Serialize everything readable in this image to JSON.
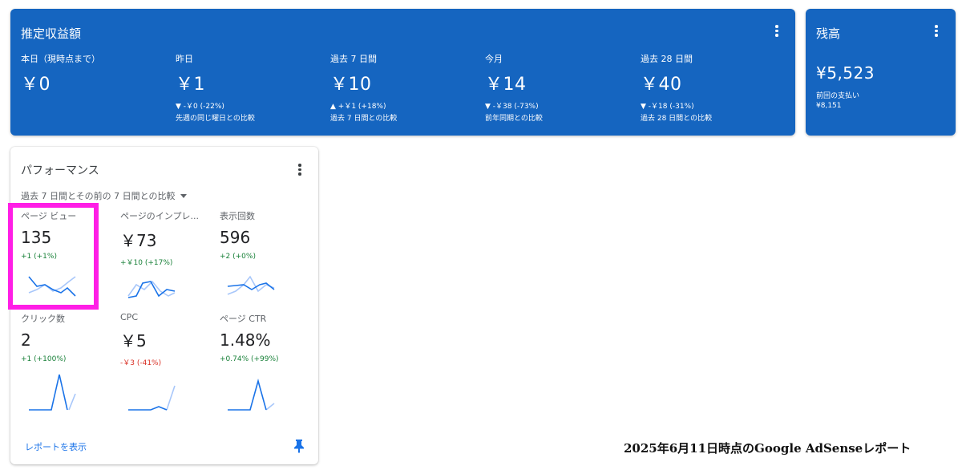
{
  "earnings": {
    "title": "推定収益額",
    "metrics": [
      {
        "label": "本日（現時点まで）",
        "value": "￥0",
        "change": "",
        "compare": ""
      },
      {
        "label": "昨日",
        "value": "￥1",
        "change": "▼ -￥0 (-22%)",
        "compare": "先週の同じ曜日との比較"
      },
      {
        "label": "過去 7 日間",
        "value": "￥10",
        "change": "▲ +￥1 (+18%)",
        "compare": "過去 7 日間との比較"
      },
      {
        "label": "今月",
        "value": "￥14",
        "change": "▼ -￥38 (-73%)",
        "compare": "前年同期との比較"
      },
      {
        "label": "過去 28 日間",
        "value": "￥40",
        "change": "▼ -￥18 (-31%)",
        "compare": "過去 28 日間との比較"
      }
    ]
  },
  "balance": {
    "title": "残高",
    "value": "¥5,523",
    "last_payment_label": "前回の支払い",
    "last_payment_value": "¥8,151"
  },
  "performance": {
    "title": "パフォーマンス",
    "compare_select": "過去 7 日間とその前の 7 日間との比較",
    "tiles": [
      {
        "label": "ページ ビュー",
        "value": "135",
        "change": "+1 (+1%)",
        "trend": "pos"
      },
      {
        "label": "ページのインプレ...",
        "value": "￥73",
        "change": "+￥10 (+17%)",
        "trend": "pos"
      },
      {
        "label": "表示回数",
        "value": "596",
        "change": "+2 (+0%)",
        "trend": "pos"
      },
      {
        "label": "クリック数",
        "value": "2",
        "change": "+1 (+100%)",
        "trend": "pos"
      },
      {
        "label": "CPC",
        "value": "￥5",
        "change": "-￥3 (-41%)",
        "trend": "neg"
      },
      {
        "label": "ページ CTR",
        "value": "1.48%",
        "change": "+0.74% (+99%)",
        "trend": "pos"
      }
    ],
    "report_link": "レポートを表示"
  },
  "caption": "2025年6月11日時点のGoogle AdSenseレポート",
  "colors": {
    "card_blue": "#1565c0",
    "highlight": "#ff1ee6",
    "positive": "#188038",
    "negative": "#d93025",
    "spark_current": "#1a73e8",
    "spark_previous": "#a8c7fa"
  }
}
